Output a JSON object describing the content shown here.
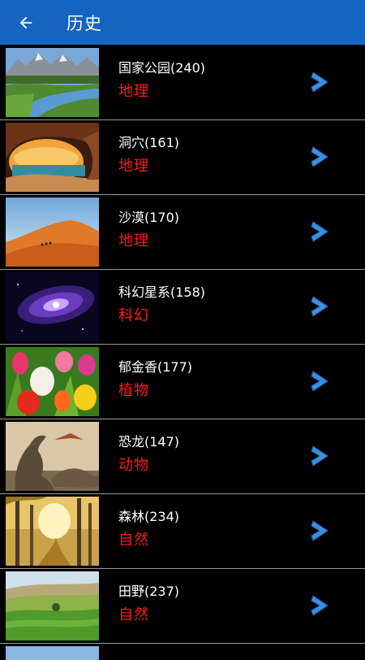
{
  "appbar": {
    "title": "历史",
    "back_icon": "arrow-left-icon",
    "color": "#1565c0"
  },
  "category_color": "#ff1a1a",
  "chevron_color": "#3b8fe0",
  "items": [
    {
      "name": "国家公园(240)",
      "category": "地理"
    },
    {
      "name": "洞穴(161)",
      "category": "地理"
    },
    {
      "name": "沙漠(170)",
      "category": "地理"
    },
    {
      "name": "科幻星系(158)",
      "category": "科幻"
    },
    {
      "name": "郁金香(177)",
      "category": "植物"
    },
    {
      "name": "恐龙(147)",
      "category": "动物"
    },
    {
      "name": "森林(234)",
      "category": "自然"
    },
    {
      "name": "田野(237)",
      "category": "自然"
    }
  ]
}
